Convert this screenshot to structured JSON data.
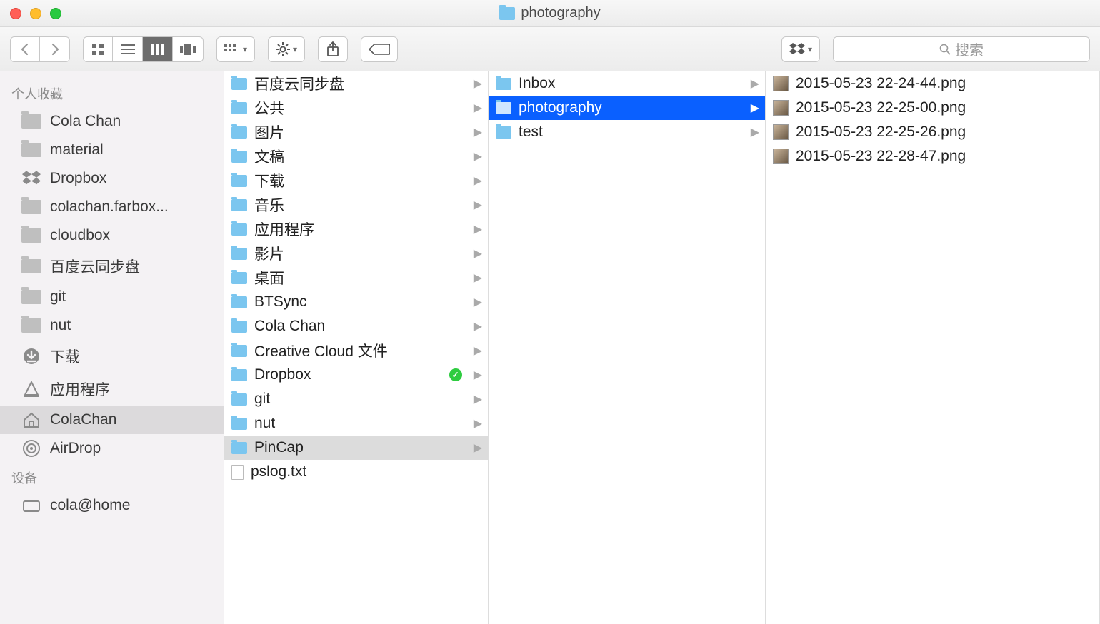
{
  "window": {
    "title": "photography"
  },
  "search": {
    "placeholder": "搜索"
  },
  "sidebar": {
    "sections": [
      {
        "header": "个人收藏",
        "items": [
          {
            "label": "Cola Chan",
            "icon": "folder"
          },
          {
            "label": "material",
            "icon": "folder"
          },
          {
            "label": "Dropbox",
            "icon": "dropbox"
          },
          {
            "label": "colachan.farbox...",
            "icon": "folder"
          },
          {
            "label": "cloudbox",
            "icon": "folder"
          },
          {
            "label": "百度云同步盘",
            "icon": "folder"
          },
          {
            "label": "git",
            "icon": "folder"
          },
          {
            "label": "nut",
            "icon": "folder"
          },
          {
            "label": "下载",
            "icon": "download"
          },
          {
            "label": "应用程序",
            "icon": "apps"
          },
          {
            "label": "ColaChan",
            "icon": "home",
            "selected": true
          },
          {
            "label": "AirDrop",
            "icon": "airdrop"
          }
        ]
      },
      {
        "header": "设备",
        "items": [
          {
            "label": "cola@home",
            "icon": "drive"
          }
        ]
      }
    ]
  },
  "columns": [
    {
      "items": [
        {
          "label": "百度云同步盘",
          "type": "folder",
          "arrow": true
        },
        {
          "label": "公共",
          "type": "folder",
          "arrow": true
        },
        {
          "label": "图片",
          "type": "folder",
          "arrow": true
        },
        {
          "label": "文稿",
          "type": "folder",
          "arrow": true
        },
        {
          "label": "下载",
          "type": "folder",
          "arrow": true
        },
        {
          "label": "音乐",
          "type": "folder",
          "arrow": true
        },
        {
          "label": "应用程序",
          "type": "folder",
          "arrow": true
        },
        {
          "label": "影片",
          "type": "folder",
          "arrow": true
        },
        {
          "label": "桌面",
          "type": "folder",
          "arrow": true
        },
        {
          "label": "BTSync",
          "type": "folder",
          "arrow": true
        },
        {
          "label": "Cola Chan",
          "type": "folder",
          "arrow": true
        },
        {
          "label": "Creative Cloud 文件",
          "type": "folder",
          "arrow": true
        },
        {
          "label": "Dropbox",
          "type": "folder",
          "arrow": true,
          "badge": "check"
        },
        {
          "label": "git",
          "type": "folder",
          "arrow": true
        },
        {
          "label": "nut",
          "type": "folder",
          "arrow": true
        },
        {
          "label": "PinCap",
          "type": "folder",
          "arrow": true,
          "pathSelected": true
        },
        {
          "label": "pslog.txt",
          "type": "file"
        }
      ]
    },
    {
      "items": [
        {
          "label": "Inbox",
          "type": "folder",
          "arrow": true
        },
        {
          "label": "photography",
          "type": "folder",
          "arrow": true,
          "selected": true
        },
        {
          "label": "test",
          "type": "folder",
          "arrow": true
        }
      ]
    },
    {
      "items": [
        {
          "label": "2015-05-23 22-24-44.png",
          "type": "image"
        },
        {
          "label": "2015-05-23 22-25-00.png",
          "type": "image"
        },
        {
          "label": "2015-05-23 22-25-26.png",
          "type": "image"
        },
        {
          "label": "2015-05-23 22-28-47.png",
          "type": "image"
        }
      ]
    }
  ]
}
